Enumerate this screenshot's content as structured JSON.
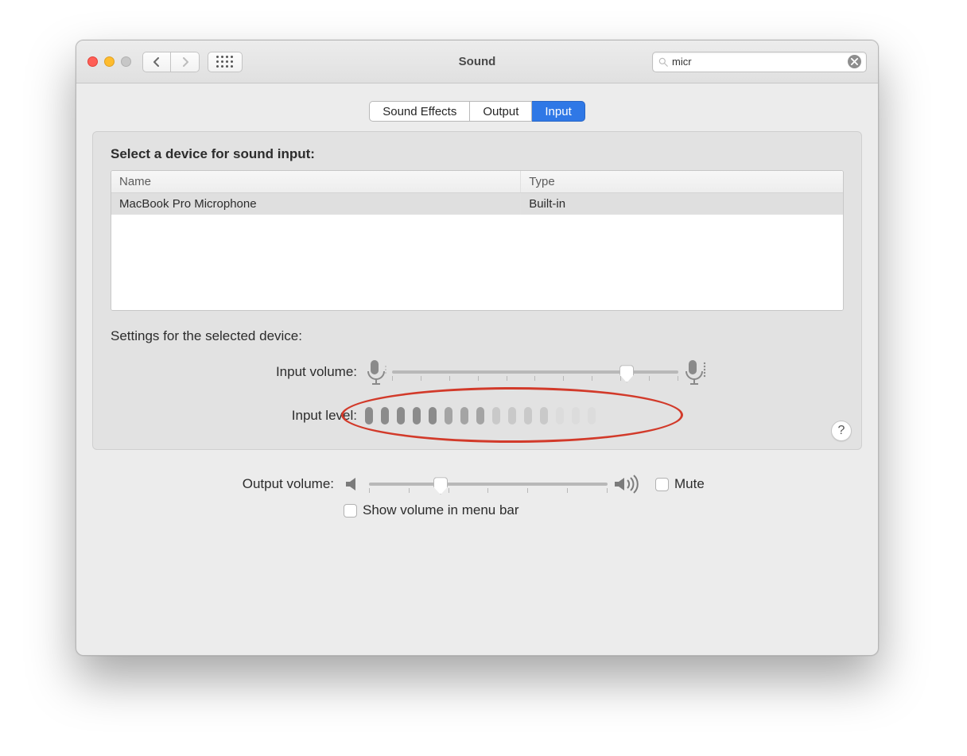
{
  "window": {
    "title": "Sound"
  },
  "search": {
    "value": "micr"
  },
  "tabs": [
    {
      "label": "Sound Effects",
      "active": false
    },
    {
      "label": "Output",
      "active": false
    },
    {
      "label": "Input",
      "active": true
    }
  ],
  "input_panel": {
    "heading": "Select a device for sound input:",
    "columns": {
      "name": "Name",
      "type": "Type"
    },
    "devices": [
      {
        "name": "MacBook Pro Microphone",
        "type": "Built-in",
        "selected": true
      }
    ],
    "settings_heading": "Settings for the selected device:",
    "input_volume_label": "Input volume:",
    "input_volume_percent": 82,
    "input_level_label": "Input level:",
    "input_level_segments": [
      "on",
      "on",
      "on",
      "on",
      "on",
      "mid",
      "mid",
      "mid",
      "dim",
      "dim",
      "dim",
      "dim",
      "off",
      "off",
      "off"
    ],
    "annotation": "input-level-highlight"
  },
  "help_label": "?",
  "footer": {
    "output_volume_label": "Output volume:",
    "output_volume_percent": 30,
    "mute_label": "Mute",
    "mute_checked": false,
    "show_volume_label": "Show volume in menu bar",
    "show_volume_checked": false
  }
}
